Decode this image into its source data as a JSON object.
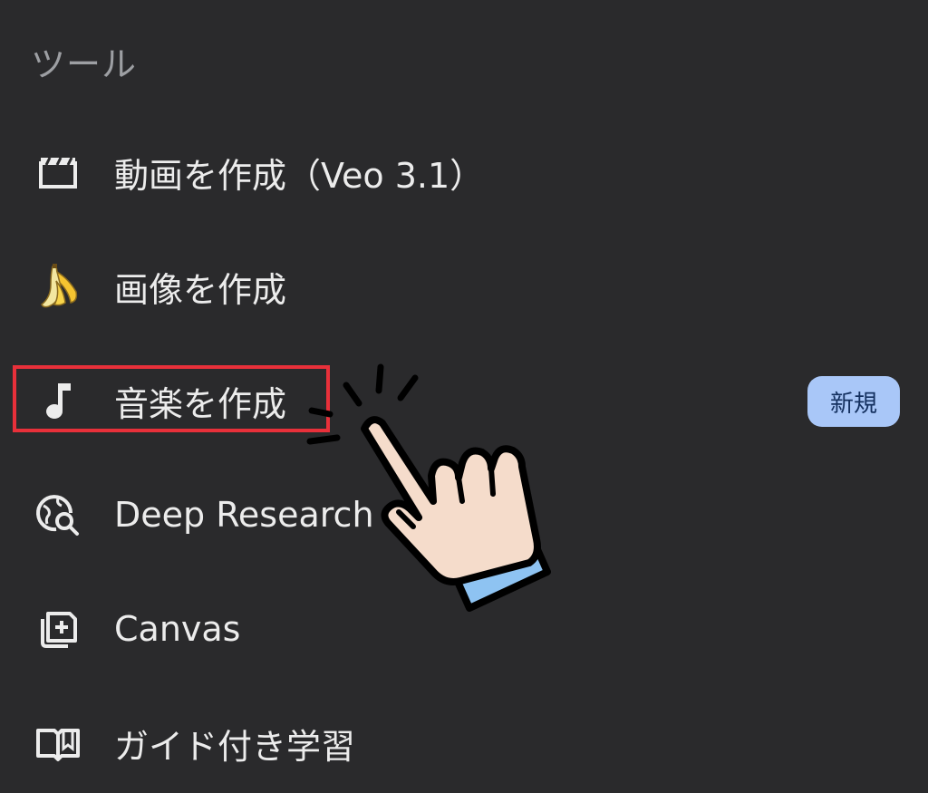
{
  "section": {
    "title": "ツール"
  },
  "tools": [
    {
      "label": "動画を作成（Veo 3.1）",
      "icon": "clapperboard-icon"
    },
    {
      "label": "画像を作成",
      "icon": "banana-icon"
    },
    {
      "label": "音楽を作成",
      "icon": "music-note-icon",
      "badge": "新規",
      "highlighted": true
    },
    {
      "label": "Deep Research",
      "icon": "globe-search-icon"
    },
    {
      "label": "Canvas",
      "icon": "canvas-add-icon"
    },
    {
      "label": "ガイド付き学習",
      "icon": "open-book-icon"
    }
  ],
  "colors": {
    "background": "#2a2a2c",
    "text": "#ececec",
    "section_title": "#9d9fa3",
    "highlight": "#e8303a",
    "badge_bg": "#a9c7f8",
    "badge_text": "#14305f"
  },
  "overlay": {
    "pointer": "pointing-hand-icon"
  }
}
